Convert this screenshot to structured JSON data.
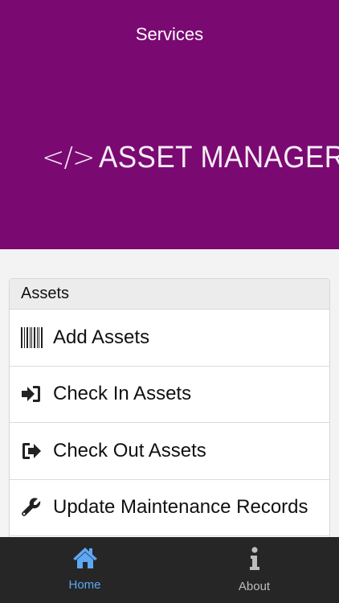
{
  "header": {
    "title": "Services",
    "logo_mark": "</>",
    "logo_text": "ASSET MANAGER",
    "background_color": "#7a0a72"
  },
  "section": {
    "title": "Assets",
    "items": [
      {
        "label": "Add Assets",
        "icon": "barcode-icon"
      },
      {
        "label": "Check In Assets",
        "icon": "sign-in-icon"
      },
      {
        "label": "Check Out Assets",
        "icon": "sign-out-icon"
      },
      {
        "label": "Update Maintenance Records",
        "icon": "wrench-icon"
      }
    ]
  },
  "tabbar": {
    "tabs": [
      {
        "label": "Home",
        "icon": "home-icon",
        "active": true
      },
      {
        "label": "About",
        "icon": "info-icon",
        "active": false
      }
    ],
    "active_color": "#5da8f4"
  }
}
